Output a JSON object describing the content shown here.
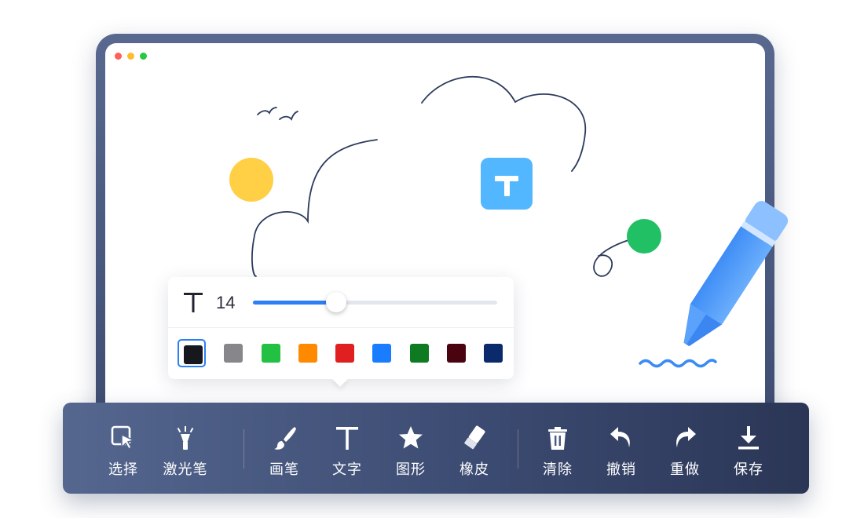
{
  "window": {
    "traffic_lights": {
      "close": "#ff5f57",
      "minimize": "#febc2e",
      "maximize": "#28c840"
    }
  },
  "canvas": {
    "shapes": {
      "sun_color": "#ffcf45",
      "dot_color": "#22c064",
      "text_badge_color": "#52b7ff",
      "stroke_color": "#2c3a5c",
      "wave_color": "#3b8bf5"
    }
  },
  "text_popup": {
    "icon": "text-t-icon",
    "font_size": "14",
    "slider_value": 0.34,
    "colors": [
      "#16181d",
      "#86868b",
      "#22c043",
      "#ff8a00",
      "#e02020",
      "#1a7cff",
      "#0e7a22",
      "#4a0410",
      "#0b2a6b"
    ],
    "selected_color_index": 0
  },
  "toolbar": {
    "groups": [
      [
        {
          "icon": "cursor-select-icon",
          "label": "选择"
        },
        {
          "icon": "laser-pointer-icon",
          "label": "激光笔"
        }
      ],
      [
        {
          "icon": "brush-icon",
          "label": "画笔"
        },
        {
          "icon": "text-icon",
          "label": "文字"
        },
        {
          "icon": "star-shape-icon",
          "label": "图形"
        },
        {
          "icon": "eraser-icon",
          "label": "橡皮"
        }
      ],
      [
        {
          "icon": "trash-icon",
          "label": "清除"
        },
        {
          "icon": "undo-icon",
          "label": "撤销"
        },
        {
          "icon": "redo-icon",
          "label": "重做"
        },
        {
          "icon": "download-icon",
          "label": "保存"
        }
      ]
    ]
  }
}
